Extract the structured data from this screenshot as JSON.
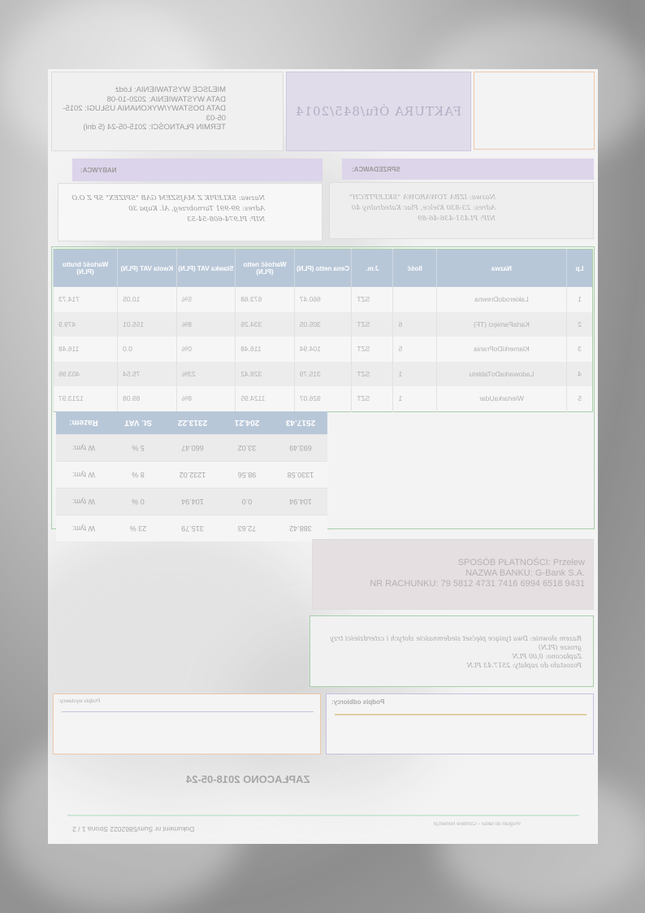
{
  "header": {
    "issue_place": "MIEJSCE WYSTAWIENIA: Łódź",
    "issue_date": "DATA WYSTAWIENIA: 2020-10-08",
    "delivery_date": "DATA DOSTAWY/WYKONANIA USŁUGI: 2015-05-03",
    "payment_term": "TERMIN PŁATNOŚCI: 2015-05-24  (5 dni)",
    "invoice_title": "FAKTURA Ófu/845/2014"
  },
  "parties": {
    "seller_label": "SPRZEDAWCA:",
    "buyer_label": "NABYWCA:",
    "seller_lines": [
      "Nazwa: IZBA TOWAROWA \"SKLEPTECH\"",
      "Adres: 23-830 Kielce, Plac Katedralny 40",
      "NIP: PL451-436-46-89"
    ],
    "buyer_lines": [
      "Nazwa: SKLEPIK Z MAJSZEM GAB \"SPIZEX\" SP Z O.O",
      "Adres: 99-991 Tarnobrzeg, Al. Kupa 30",
      "NIP: PL974-608-54-53"
    ]
  },
  "items": {
    "headers": [
      "Lp",
      "Nazwa",
      "Ilość",
      "J.m.",
      "Cena netto (PLN)",
      "Wartość netto (PLN)",
      "Stawka VAT (PLN)",
      "Kwota VAT (PLN)",
      "Wartość brutto (PLN)"
    ],
    "rows": [
      [
        "1",
        "LakierodoDrewna",
        "",
        "SZT",
        "660.47",
        "673.68",
        "5%",
        "10.05",
        "714.73"
      ],
      [
        "2",
        "KartaPamięci (TF)",
        "6",
        "SZT",
        "305.05",
        "334.26",
        "8%",
        "155.01",
        "479.9"
      ],
      [
        "3",
        "KlamerkiDoPrania",
        "5",
        "SZT",
        "104.94",
        "116.48",
        "0%",
        "0.0",
        "116.48"
      ],
      [
        "4",
        "LadowarkaDoTabletu",
        "1",
        "SZT",
        "315.79",
        "328.42",
        "23%",
        "75.54",
        "403.96"
      ],
      [
        "5",
        "WiertarkaUdar",
        "1",
        "SZT",
        "926.07",
        "1124.95",
        "8%",
        "89.08",
        "1213.97"
      ]
    ]
  },
  "summary": {
    "headers": [
      "Razem:",
      "St. VAT",
      "2313.22",
      "204.21",
      "2517.43"
    ],
    "rows": [
      [
        "W tym:",
        "5 %",
        "660.47",
        "33.02",
        "693.49"
      ],
      [
        "W tym:",
        "8 %",
        "1232.02",
        "98.56",
        "1330.58"
      ],
      [
        "W tym:",
        "0 %",
        "104.94",
        "0.0",
        "104.94"
      ],
      [
        "W tym:",
        "23 %",
        "315.79",
        "72.63",
        "388.42"
      ]
    ]
  },
  "payment": {
    "method": "SPOSÓB PŁATNOŚCI: Przelew",
    "bank": "NAZWA BANKU: G-Bank S.A.",
    "account": "NR RACHUNKU: 79 5812 4731 7416 6994 6518 9431"
  },
  "totals": {
    "in_words": "Razem słownie: Dwa tysiące pięćset siedemnaście złotych i czterdzieści trzy grosze (PLN)",
    "paid": "Zapłacono: 0,00 PLN",
    "remaining": "Pozostało do zapłaty: 2517.43 PLN"
  },
  "signatures": {
    "receiver": "Podpis odbiorcy:",
    "issuer": "Podpis wystawcy:"
  },
  "stamp": "ZAPŁACONO 2018-05-24",
  "footer": {
    "doc_number": "Dokument nr Śum/5862022 Strona 1 / 2",
    "program": "Program do faktur – Combine Norbert.pl"
  },
  "colors": {
    "invoice_title_bg": "#e0dcea",
    "header_bg": "#b8c7d8",
    "green_border": "#a9cfa9",
    "orange_border": "#f0c7a8",
    "purple_border": "#c8c0e0"
  }
}
